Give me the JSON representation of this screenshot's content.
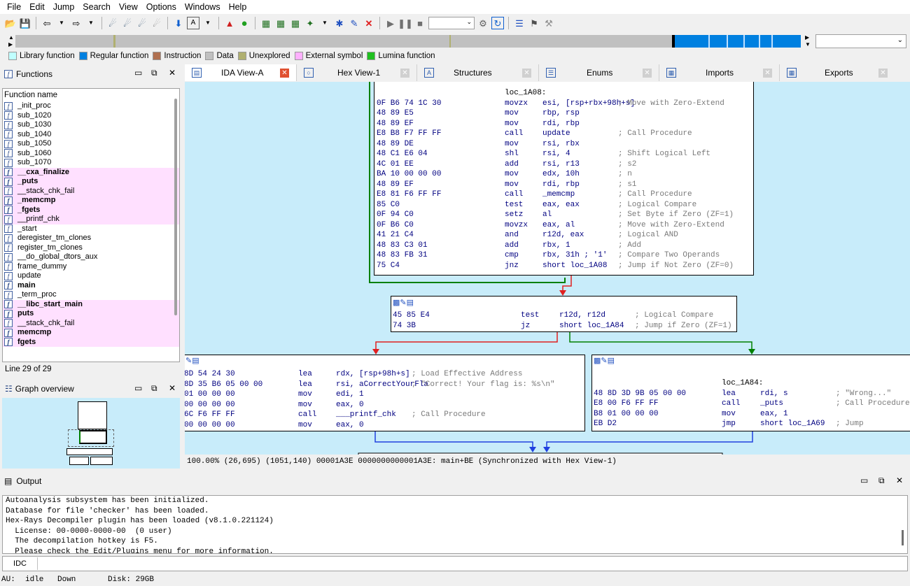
{
  "menu": [
    "File",
    "Edit",
    "Jump",
    "Search",
    "View",
    "Options",
    "Windows",
    "Help"
  ],
  "legend": [
    {
      "label": "Library function",
      "color": "#c0ffff"
    },
    {
      "label": "Regular function",
      "color": "#0080e0"
    },
    {
      "label": "Instruction",
      "color": "#b07050"
    },
    {
      "label": "Data",
      "color": "#c0c0c0"
    },
    {
      "label": "Unexplored",
      "color": "#b0b070"
    },
    {
      "label": "External symbol",
      "color": "#ffb0ff"
    },
    {
      "label": "Lumina function",
      "color": "#20c020"
    }
  ],
  "functions_panel": {
    "title": "Functions",
    "column_header": "Function name",
    "items": [
      {
        "name": "_init_proc",
        "style": "normal"
      },
      {
        "name": "sub_1020",
        "style": "normal"
      },
      {
        "name": "sub_1030",
        "style": "normal"
      },
      {
        "name": "sub_1040",
        "style": "normal"
      },
      {
        "name": "sub_1050",
        "style": "normal"
      },
      {
        "name": "sub_1060",
        "style": "normal"
      },
      {
        "name": "sub_1070",
        "style": "normal"
      },
      {
        "name": "__cxa_finalize",
        "style": "pink-bold"
      },
      {
        "name": "_puts",
        "style": "pink-bold"
      },
      {
        "name": "__stack_chk_fail",
        "style": "pink"
      },
      {
        "name": "_memcmp",
        "style": "pink-bold"
      },
      {
        "name": "_fgets",
        "style": "pink-bold"
      },
      {
        "name": "__printf_chk",
        "style": "pink"
      },
      {
        "name": "_start",
        "style": "normal"
      },
      {
        "name": "deregister_tm_clones",
        "style": "normal"
      },
      {
        "name": "register_tm_clones",
        "style": "normal"
      },
      {
        "name": "__do_global_dtors_aux",
        "style": "normal"
      },
      {
        "name": "frame_dummy",
        "style": "normal"
      },
      {
        "name": "update",
        "style": "normal"
      },
      {
        "name": "main",
        "style": "bold"
      },
      {
        "name": "_term_proc",
        "style": "normal"
      },
      {
        "name": "__libc_start_main",
        "style": "pink-bold"
      },
      {
        "name": "puts",
        "style": "pink-bold"
      },
      {
        "name": "__stack_chk_fail",
        "style": "pink"
      },
      {
        "name": "memcmp",
        "style": "pink-bold"
      },
      {
        "name": "fgets",
        "style": "pink-bold"
      }
    ],
    "line_status": "Line 29 of 29"
  },
  "graph_overview": {
    "title": "Graph overview"
  },
  "tabs": [
    {
      "label": "IDA View-A",
      "active": true,
      "icon": "ida-view-icon"
    },
    {
      "label": "Hex View-1",
      "active": false,
      "icon": "hex-view-icon"
    },
    {
      "label": "Structures",
      "active": false,
      "icon": "structures-icon"
    },
    {
      "label": "Enums",
      "active": false,
      "icon": "enums-icon"
    },
    {
      "label": "Imports",
      "active": false,
      "icon": "imports-icon"
    },
    {
      "label": "Exports",
      "active": false,
      "icon": "exports-icon"
    }
  ],
  "graph": {
    "node1": {
      "label": "loc_1A08:",
      "lines": [
        {
          "bytes": "0F B6 74 1C 30",
          "mn": "movzx",
          "op": "esi, [rsp+rbx+98h+s]",
          "cmt": "; Move with Zero-Extend"
        },
        {
          "bytes": "48 89 E5",
          "mn": "mov",
          "op": "rbp, rsp",
          "cmt": ""
        },
        {
          "bytes": "48 89 EF",
          "mn": "mov",
          "op": "rdi, rbp",
          "cmt": ""
        },
        {
          "bytes": "E8 B8 F7 FF FF",
          "mn": "call",
          "op": "update",
          "cmt": "; Call Procedure"
        },
        {
          "bytes": "48 89 DE",
          "mn": "mov",
          "op": "rsi, rbx",
          "cmt": ""
        },
        {
          "bytes": "48 C1 E6 04",
          "mn": "shl",
          "op": "rsi, 4",
          "cmt": "; Shift Logical Left"
        },
        {
          "bytes": "4C 01 EE",
          "mn": "add",
          "op": "rsi, r13",
          "cmt": "; s2"
        },
        {
          "bytes": "BA 10 00 00 00",
          "mn": "mov",
          "op": "edx, 10h",
          "cmt": "; n"
        },
        {
          "bytes": "48 89 EF",
          "mn": "mov",
          "op": "rdi, rbp",
          "cmt": "; s1"
        },
        {
          "bytes": "E8 81 F6 FF FF",
          "mn": "call",
          "op": "_memcmp",
          "cmt": "; Call Procedure"
        },
        {
          "bytes": "85 C0",
          "mn": "test",
          "op": "eax, eax",
          "cmt": "; Logical Compare"
        },
        {
          "bytes": "0F 94 C0",
          "mn": "setz",
          "op": "al",
          "cmt": "; Set Byte if Zero (ZF=1)"
        },
        {
          "bytes": "0F B6 C0",
          "mn": "movzx",
          "op": "eax, al",
          "cmt": "; Move with Zero-Extend"
        },
        {
          "bytes": "41 21 C4",
          "mn": "and",
          "op": "r12d, eax",
          "cmt": "; Logical AND"
        },
        {
          "bytes": "48 83 C3 01",
          "mn": "add",
          "op": "rbx, 1",
          "cmt": "; Add"
        },
        {
          "bytes": "48 83 FB 31",
          "mn": "cmp",
          "op": "rbx, 31h ; '1'",
          "cmt": "; Compare Two Operands"
        },
        {
          "bytes": "75 C4",
          "mn": "jnz",
          "op": "short loc_1A08",
          "cmt": "; Jump if Not Zero (ZF=0)"
        }
      ]
    },
    "node2": {
      "lines": [
        {
          "bytes": "45 85 E4",
          "mn": "test",
          "op": "r12d, r12d",
          "cmt": "; Logical Compare"
        },
        {
          "bytes": "74 3B",
          "mn": "jz",
          "op": "short loc_1A84",
          "cmt": "; Jump if Zero (ZF=1)"
        }
      ]
    },
    "node3": {
      "lines": [
        {
          "bytes": "8D 54 24 30",
          "mn": "lea",
          "op": "rdx, [rsp+98h+s]",
          "cmt": "; Load Effective Address"
        },
        {
          "bytes": "8D 35 B6 05 00 00",
          "mn": "lea",
          "op": "rsi, aCorrectYourFla",
          "cmt": "; \"Correct! Your flag is: %s\\n\""
        },
        {
          "bytes": "01 00 00 00",
          "mn": "mov",
          "op": "edi, 1",
          "cmt": ""
        },
        {
          "bytes": "00 00 00 00",
          "mn": "mov",
          "op": "eax, 0",
          "cmt": ""
        },
        {
          "bytes": "6C F6 FF FF",
          "mn": "call",
          "op": "___printf_chk",
          "cmt": "; Call Procedure"
        },
        {
          "bytes": "00 00 00 00",
          "mn": "mov",
          "op": "eax, 0",
          "cmt": ""
        }
      ]
    },
    "node4": {
      "label": "loc_1A84:",
      "lines": [
        {
          "bytes": "48 8D 3D 9B 05 00 00",
          "mn": "lea",
          "op": "rdi, s",
          "cmt": "; \"Wrong...\""
        },
        {
          "bytes": "E8 00 F6 FF FF",
          "mn": "call",
          "op": "_puts",
          "cmt": "; Call Procedure"
        },
        {
          "bytes": "B8 01 00 00 00",
          "mn": "mov",
          "op": "eax, 1",
          "cmt": ""
        },
        {
          "bytes": "EB D2",
          "mn": "jmp",
          "op": "short loc_1A69",
          "cmt": "; Jump"
        }
      ]
    }
  },
  "status_line": "100.00% (26,695) (1051,140) 00001A3E 0000000000001A3E: main+BE (Synchronized with Hex View-1)",
  "output": {
    "title": "Output",
    "lines": [
      "Autoanalysis subsystem has been initialized.",
      "Database for file 'checker' has been loaded.",
      "Hex-Rays Decompiler plugin has been loaded (v8.1.0.221124)",
      "  License: 00-0000-0000-00  (0 user)",
      "  The decompilation hotkey is F5.",
      "  Please check the Edit/Plugins menu for more information."
    ]
  },
  "idc_label": "IDC",
  "bottom_status": {
    "au": "AU:",
    "state": "idle",
    "direction": "Down",
    "disk": "Disk: 29GB"
  }
}
